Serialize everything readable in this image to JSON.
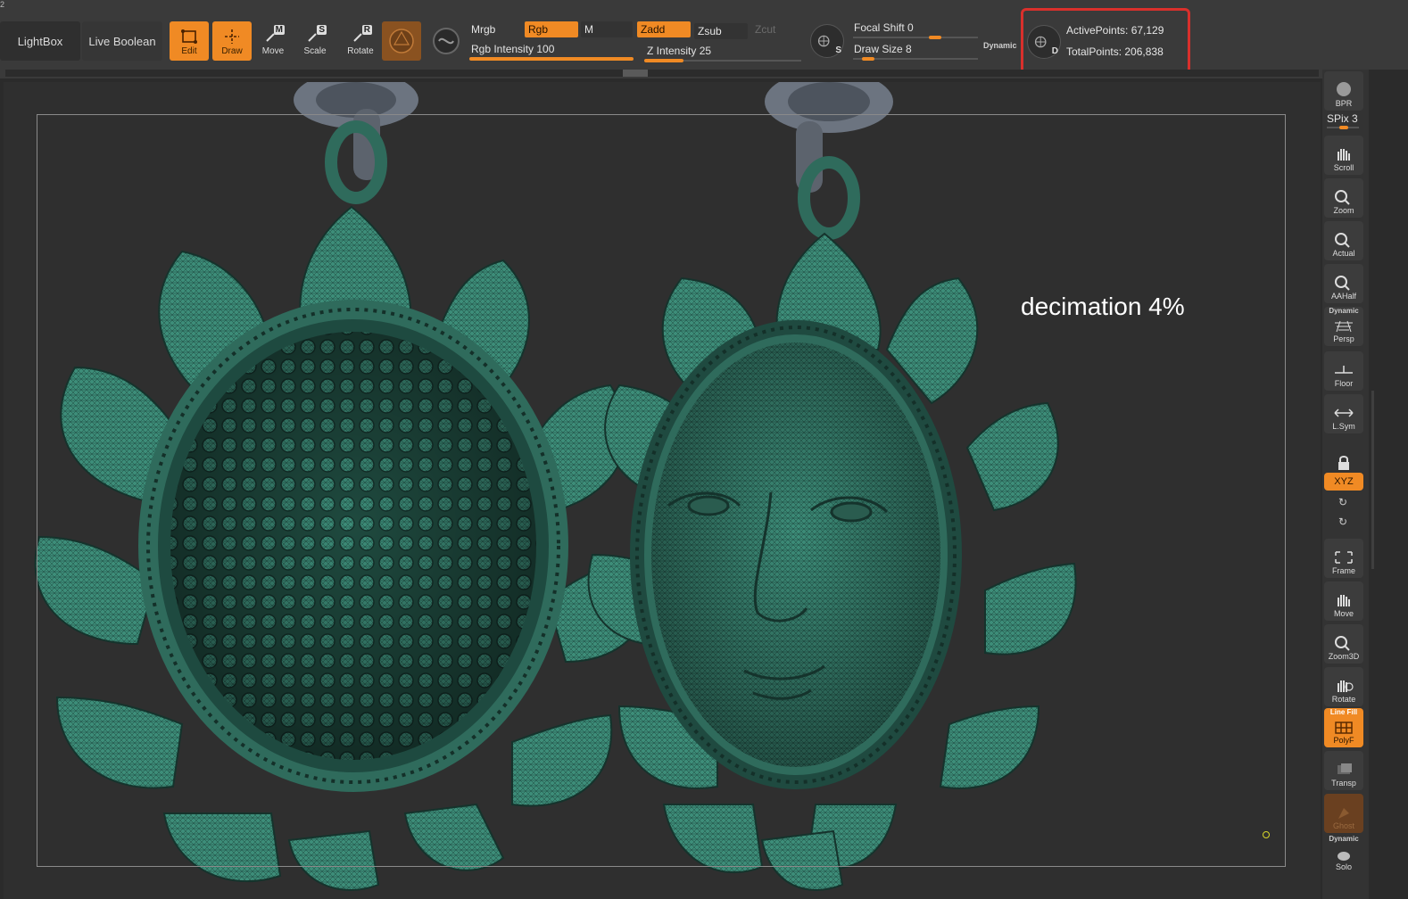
{
  "version_mark": "2",
  "toolbar": {
    "lightbox": "LightBox",
    "live_boolean": "Live Boolean",
    "tools": [
      {
        "label": "Edit",
        "key": "",
        "active": true
      },
      {
        "label": "Draw",
        "key": "",
        "active": true
      },
      {
        "label": "Move",
        "key": "M",
        "active": false
      },
      {
        "label": "Scale",
        "key": "S",
        "active": false
      },
      {
        "label": "Rotate",
        "key": "R",
        "active": false
      }
    ],
    "mrgb": "Mrgb",
    "rgb": "Rgb",
    "m": "M",
    "rgb_intensity": "Rgb Intensity 100",
    "rgb_intensity_value": 100,
    "zadd": "Zadd",
    "zsub": "Zsub",
    "zcut": "Zcut",
    "z_intensity": "Z Intensity 25",
    "z_intensity_value": 25,
    "s_key": "S",
    "focal_shift": "Focal Shift 0",
    "draw_size": "Draw Size 8",
    "dynamic": "Dynamic",
    "d_key": "D",
    "active_points": "ActivePoints: 67,129",
    "total_points": "TotalPoints: 206,838"
  },
  "canvas": {
    "annotation": "decimation 4%"
  },
  "shelf": {
    "bpr": "BPR",
    "spix": "SPix 3",
    "scroll": "Scroll",
    "zoom": "Zoom",
    "actual": "Actual",
    "aahalf": "AAHalf",
    "persp_top": "Dynamic",
    "persp": "Persp",
    "floor": "Floor",
    "lsym": "L.Sym",
    "xyz": "XYZ",
    "frame": "Frame",
    "move": "Move",
    "zoom3d": "Zoom3D",
    "rotate": "Rotate",
    "polyf_top": "Line Fill",
    "polyf": "PolyF",
    "transp": "Transp",
    "ghost": "Ghost",
    "solo_top": "Dynamic",
    "solo": "Solo"
  },
  "colors": {
    "accent": "#f08a24",
    "highlight_box": "#d9302c",
    "mesh": "#3f8f7c"
  }
}
